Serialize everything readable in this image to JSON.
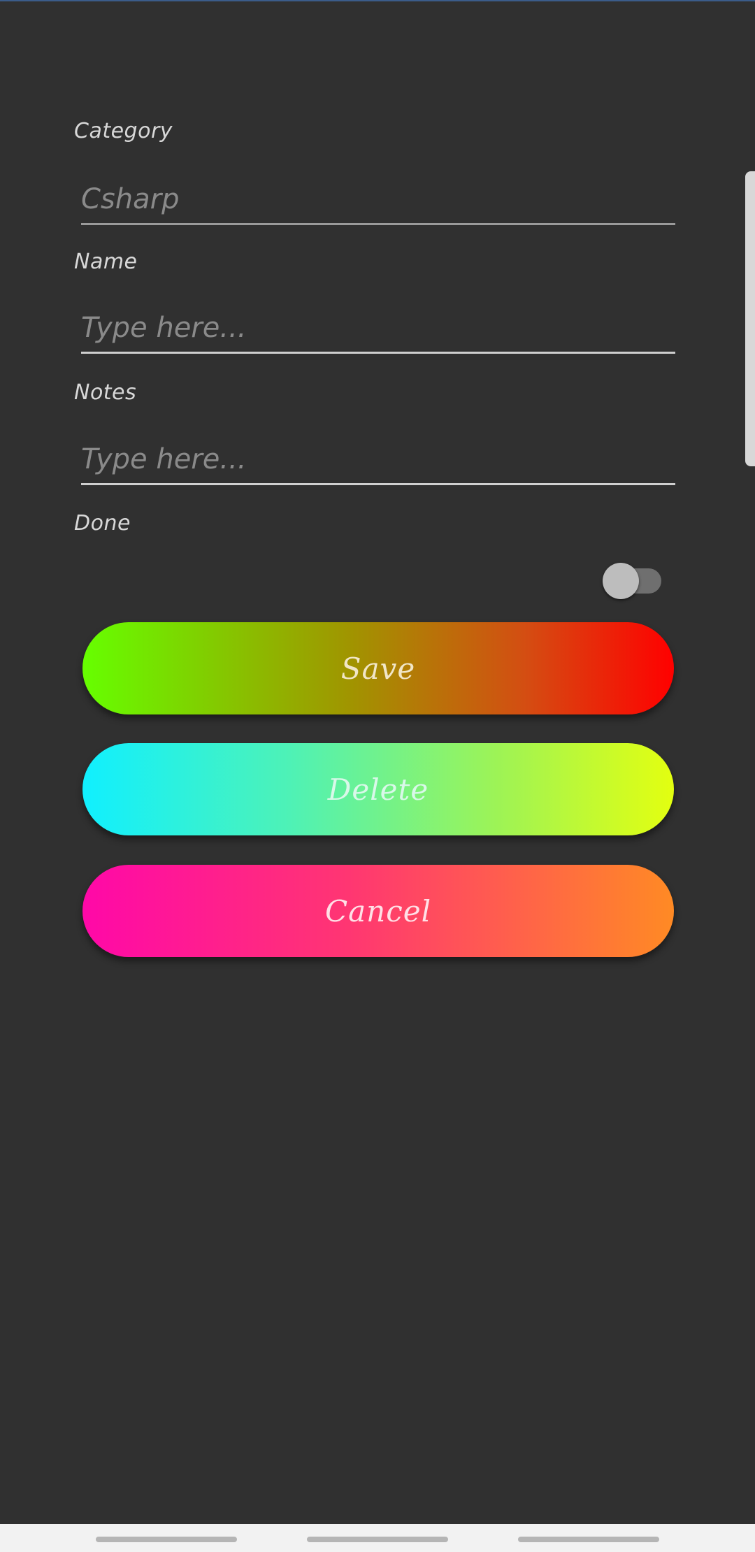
{
  "form": {
    "category": {
      "label": "Category",
      "placeholder": "Csharp",
      "value": ""
    },
    "name": {
      "label": "Name",
      "placeholder": "Type here...",
      "value": ""
    },
    "notes": {
      "label": "Notes",
      "placeholder": "Type here...",
      "value": ""
    },
    "done": {
      "label": "Done",
      "checked": false
    }
  },
  "buttons": {
    "save_label": "Save",
    "delete_label": "Delete",
    "cancel_label": "Cancel"
  },
  "theme": {
    "background": "#303030",
    "save_gradient": [
      "#66ff00",
      "#ff0000"
    ],
    "delete_gradient": [
      "#10f0ff",
      "#e3ff10"
    ],
    "cancel_gradient": [
      "#ff08a8",
      "#ff8a24"
    ]
  },
  "navigation_bar": {
    "items": [
      "recents-pill",
      "home-pill",
      "back-pill"
    ]
  }
}
